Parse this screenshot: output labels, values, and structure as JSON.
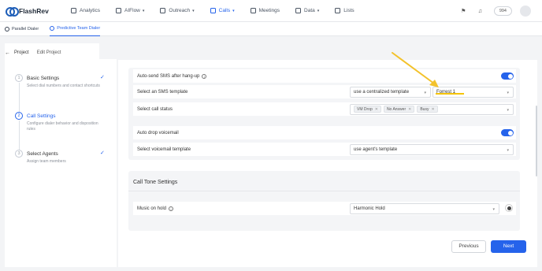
{
  "app": {
    "name": "FlashRev"
  },
  "nav": {
    "items": [
      {
        "label": "Analytics",
        "icon": "analytics-icon"
      },
      {
        "label": "AIFlow",
        "icon": "aiflow-icon",
        "dropdown": true
      },
      {
        "label": "Outreach",
        "icon": "outreach-icon",
        "dropdown": true
      },
      {
        "label": "Calls",
        "icon": "calls-icon",
        "dropdown": true,
        "active": true
      },
      {
        "label": "Meetings",
        "icon": "meetings-icon"
      },
      {
        "label": "Data",
        "icon": "data-icon",
        "dropdown": true
      },
      {
        "label": "Lists",
        "icon": "lists-icon"
      }
    ],
    "badge_count": "994"
  },
  "subtabs": [
    {
      "label": "Parallel Dialer",
      "active": false
    },
    {
      "label": "Predictive Team Dialer",
      "active": true
    }
  ],
  "header": {
    "back_label": "Project",
    "edit_label": "Edit Project"
  },
  "steps": [
    {
      "num": "1",
      "title": "Basic Settings",
      "desc": "Select dial numbers and contact shortcuts",
      "done": true
    },
    {
      "num": "2",
      "title": "Call Settings",
      "desc": "Configure dialer behavior and disposition rules",
      "active": true
    },
    {
      "num": "3",
      "title": "Select Agents",
      "desc": "Assign team members",
      "done": true
    }
  ],
  "call_settings": {
    "auto_sms_label": "Auto-send SMS after hang-up",
    "auto_sms_enabled": true,
    "sms_template_label": "Select an SMS template",
    "sms_template_mode": "use a centralized template",
    "sms_template_value": "Forrest 1",
    "call_status_label": "Select call status",
    "call_status_tags": [
      "VM Drop",
      "No Answer",
      "Busy"
    ],
    "auto_drop_label": "Auto drop voicemail",
    "auto_drop_enabled": true,
    "vm_template_label": "Select voicemail template",
    "vm_template_value": "use agent's template"
  },
  "call_tone": {
    "title": "Call Tone Settings",
    "music_label": "Music on hold",
    "music_value": "Harmonic Hold"
  },
  "footer": {
    "previous_label": "Previous",
    "next_label": "Next"
  },
  "colors": {
    "accent": "#2563eb",
    "highlight": "#f5c400",
    "annotation_arrow": "#f3c22b"
  }
}
